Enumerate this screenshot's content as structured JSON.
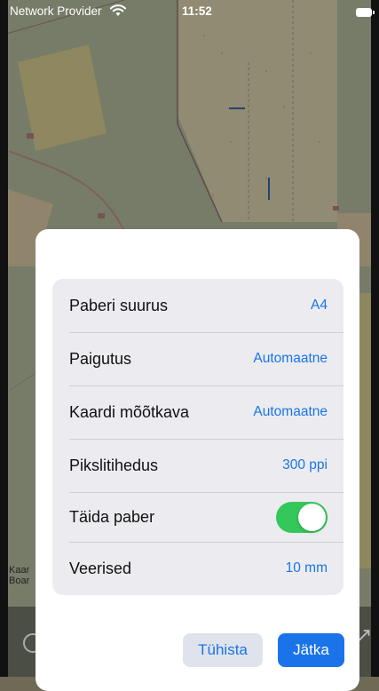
{
  "status_bar": {
    "carrier": "Network Provider",
    "time": "11:52",
    "wifi_icon": "wifi-icon",
    "battery_icon": "battery-icon"
  },
  "map": {
    "label_line1": "Kaar",
    "label_line2": "Boar"
  },
  "dialog": {
    "rows": [
      {
        "label": "Paberi suurus",
        "value": "A4"
      },
      {
        "label": "Paigutus",
        "value": "Automaatne"
      },
      {
        "label": "Kaardi mõõtkava",
        "value": "Automaatne"
      },
      {
        "label": "Pikslitihedus",
        "value": "300 ppi"
      },
      {
        "label": "Täida paber",
        "toggle_on": true
      },
      {
        "label": "Veerised",
        "value": "10 mm"
      }
    ],
    "cancel_label": "Tühista",
    "continue_label": "Jätka"
  },
  "colors": {
    "accent": "#1a73e8",
    "toggle_on": "#34c759"
  }
}
